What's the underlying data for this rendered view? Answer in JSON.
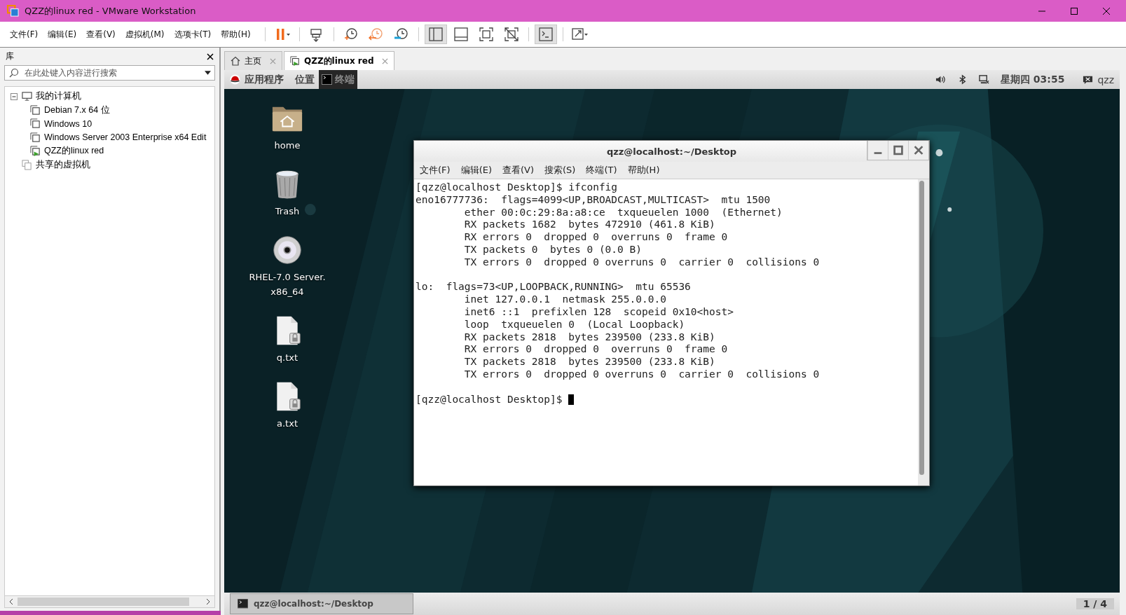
{
  "window": {
    "title": "QZZ的linux red - VMware Workstation"
  },
  "menu": [
    "文件(F)",
    "编辑(E)",
    "查看(V)",
    "虚拟机(M)",
    "选项卡(T)",
    "帮助(H)"
  ],
  "toolbar": [
    [
      {
        "kind": "pause",
        "pressed": false
      }
    ],
    [
      {
        "kind": "send-keys",
        "pressed": false
      }
    ],
    [
      {
        "kind": "snapshot",
        "pressed": false
      },
      {
        "kind": "revert",
        "pressed": false
      },
      {
        "kind": "snapshot-manager",
        "pressed": false
      }
    ],
    [
      {
        "kind": "library",
        "pressed": true
      },
      {
        "kind": "thumbnail",
        "pressed": false
      },
      {
        "kind": "fullscreen",
        "pressed": false
      },
      {
        "kind": "unity",
        "pressed": false
      }
    ],
    [
      {
        "kind": "console",
        "pressed": true
      }
    ],
    [
      {
        "kind": "stretch",
        "pressed": false
      }
    ]
  ],
  "library": {
    "title": "库",
    "search": {
      "placeholder": "在此处键入内容进行搜索"
    },
    "tree": [
      {
        "label": "我的计算机",
        "kind": "computer",
        "expanded": true,
        "children": [
          {
            "label": "Debian 7.x 64 位",
            "kind": "vm",
            "running": false
          },
          {
            "label": "Windows 10",
            "kind": "vm",
            "running": false
          },
          {
            "label": "Windows Server 2003 Enterprise x64 Edit",
            "kind": "vm",
            "running": false
          },
          {
            "label": "QZZ的linux red",
            "kind": "vm",
            "running": true
          }
        ]
      },
      {
        "label": "共享的虚拟机",
        "kind": "shared"
      }
    ]
  },
  "tabs": [
    {
      "label": "主页",
      "kind": "home",
      "selected": false
    },
    {
      "label": "QZZ的linux red",
      "kind": "vm",
      "selected": true
    }
  ],
  "guest": {
    "top_bar": {
      "applications": "应用程序",
      "places": "位置",
      "task": "终端",
      "clock": "星期四 03:55",
      "user": "qzz"
    },
    "desktop_icons": [
      {
        "label": "home",
        "kind": "folder"
      },
      {
        "label": "Trash",
        "kind": "trash"
      },
      {
        "label": "RHEL-7.0 Server.\nx86_64",
        "kind": "disc"
      },
      {
        "label": "q.txt",
        "kind": "locked-file"
      },
      {
        "label": "a.txt",
        "kind": "locked-file"
      }
    ],
    "terminal": {
      "title": "qzz@localhost:~/Desktop",
      "menu": [
        "文件(F)",
        "编辑(E)",
        "查看(V)",
        "搜索(S)",
        "终端(T)",
        "帮助(H)"
      ],
      "blocks": [
        [
          "[qzz@localhost Desktop]$ ifconfig",
          "eno16777736:  flags=4099<UP,BROADCAST,MULTICAST>  mtu 1500",
          "        ether 00:0c:29:8a:a8:ce  txqueuelen 1000  (Ethernet)",
          "        RX packets 1682  bytes 472910 (461.8 KiB)",
          "        RX errors 0  dropped 0  overruns 0  frame 0",
          "        TX packets 0  bytes 0 (0.0 B)",
          "        TX errors 0  dropped 0 overruns 0  carrier 0  collisions 0"
        ],
        [
          "lo:  flags=73<UP,LOOPBACK,RUNNING>  mtu 65536",
          "        inet 127.0.0.1  netmask 255.0.0.0",
          "        inet6 ::1  prefixlen 128  scopeid 0x10<host>",
          "        loop  txqueuelen 0  (Local Loopback)",
          "        RX packets 2818  bytes 239500 (233.8 KiB)",
          "        RX errors 0  dropped 0  overruns 0  frame 0",
          "        TX packets 2818  bytes 239500 (233.8 KiB)",
          "        TX errors 0  dropped 0 overruns 0  carrier 0  collisions 0"
        ]
      ],
      "prompt": "[qzz@localhost Desktop]$ "
    },
    "taskbar": [
      {
        "label": "qzz@localhost:~/Desktop",
        "selected": false
      }
    ],
    "workspace": "1 / 4"
  }
}
